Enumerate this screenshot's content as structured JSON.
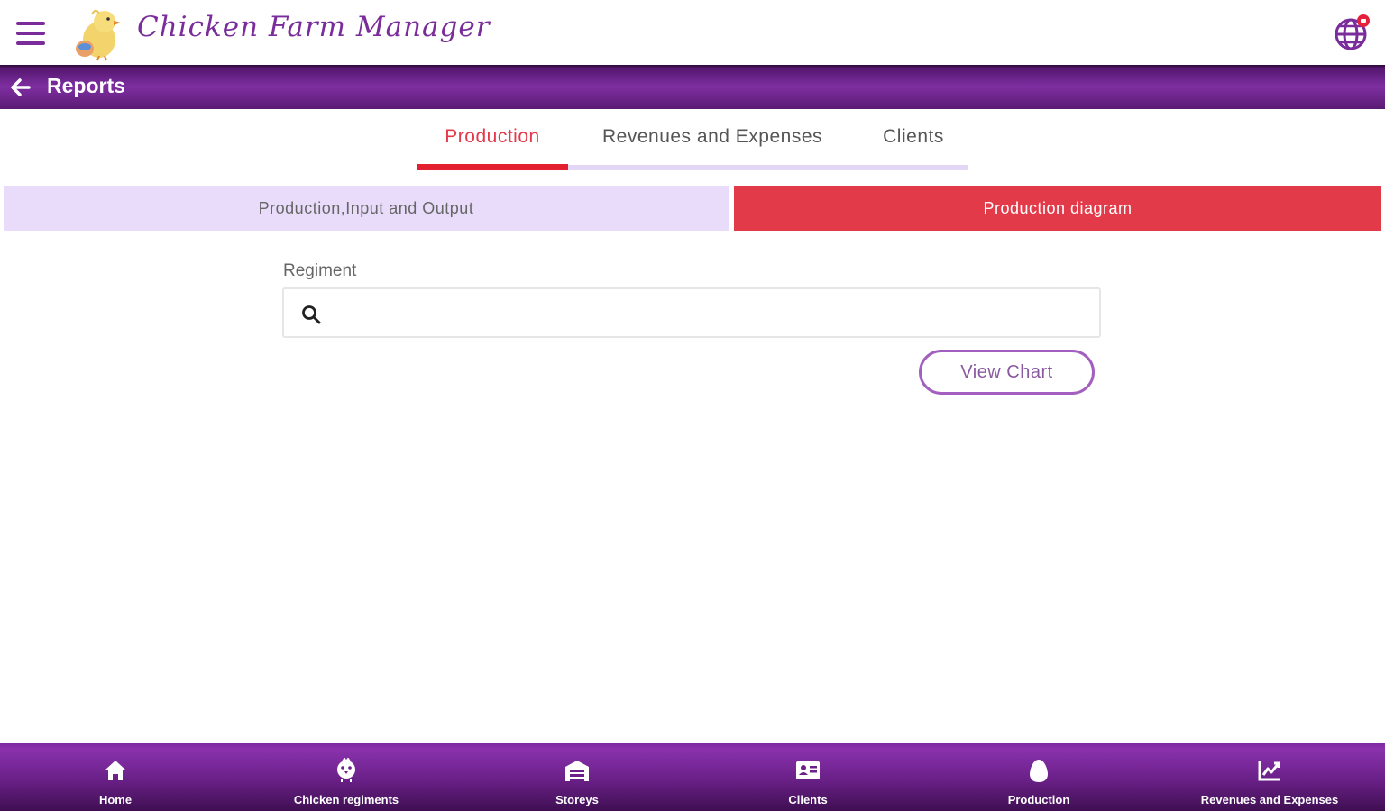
{
  "header": {
    "app_title": "Chicken Farm Manager",
    "menu_icon": "hamburger-menu-icon",
    "logo_icon": "chick-logo",
    "language_icon": "globe-icon",
    "notification_badge_color": "#e5203a"
  },
  "subheader": {
    "title": "Reports",
    "back_icon": "arrow-left-icon"
  },
  "tabs": [
    {
      "label": "Production",
      "active": true
    },
    {
      "label": "Revenues and Expenses",
      "active": false
    },
    {
      "label": "Clients",
      "active": false
    }
  ],
  "toggle": {
    "left_label": "Production,Input and Output",
    "right_label": "Production diagram",
    "selected": "right"
  },
  "regiment": {
    "label": "Regiment",
    "value": "",
    "icon": "search-icon"
  },
  "view_chart_label": "View Chart",
  "bottom_nav": [
    {
      "label": "Home",
      "icon": "home-icon"
    },
    {
      "label": "Chicken regiments",
      "icon": "chick-icon"
    },
    {
      "label": "Storeys",
      "icon": "warehouse-icon"
    },
    {
      "label": "Clients",
      "icon": "id-card-icon"
    },
    {
      "label": "Production",
      "icon": "egg-icon"
    },
    {
      "label": "Revenues and Expenses",
      "icon": "chart-line-icon"
    }
  ],
  "colors": {
    "primary_purple": "#7a2d9a",
    "accent_red": "#e23a48",
    "toggle_inactive_bg": "#e8dcfa",
    "tab_track": "#e2d8f5"
  }
}
